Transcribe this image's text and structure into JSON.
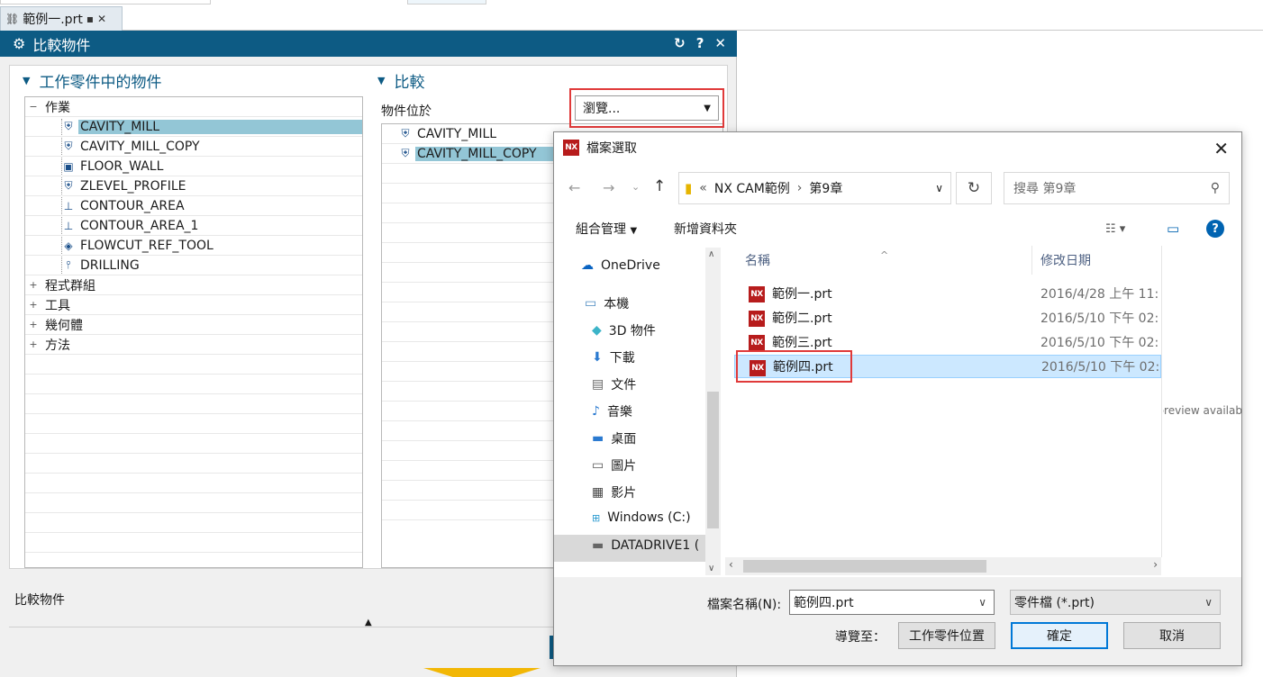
{
  "document_tab": {
    "title": "範例一.prt"
  },
  "compare_dialog": {
    "title": "比較物件",
    "left_section": {
      "header": "工作零件中的物件",
      "tree": {
        "group_ops": "作業",
        "operations": [
          "CAVITY_MILL",
          "CAVITY_MILL_COPY",
          "FLOOR_WALL",
          "ZLEVEL_PROFILE",
          "CONTOUR_AREA",
          "CONTOUR_AREA_1",
          "FLOWCUT_REF_TOOL",
          "DRILLING"
        ],
        "groups": [
          "程式群組",
          "工具",
          "幾何體",
          "方法"
        ]
      }
    },
    "right_section": {
      "header": "比較",
      "location_label": "物件位於",
      "browse_value": "瀏覽...",
      "tree_items": [
        "CAVITY_MILL",
        "CAVITY_MILL_COPY"
      ]
    },
    "bottom_label": "比較物件"
  },
  "file_dialog": {
    "title": "檔案選取",
    "address": {
      "prefix": "«",
      "path1": "NX CAM範例",
      "sep": "›",
      "path2": "第9章"
    },
    "search_placeholder": "搜尋 第9章",
    "toolbar": {
      "organize": "組合管理",
      "new_folder": "新增資料夾"
    },
    "nav_items": [
      "OneDrive",
      "本機",
      "3D 物件",
      "下載",
      "文件",
      "音樂",
      "桌面",
      "圖片",
      "影片",
      "Windows (C:)",
      "DATADRIVE1 ("
    ],
    "columns": {
      "name": "名稱",
      "date": "修改日期"
    },
    "files": [
      {
        "name": "範例一.prt",
        "date": "2016/4/28 上午 11:"
      },
      {
        "name": "範例二.prt",
        "date": "2016/5/10 下午 02:"
      },
      {
        "name": "範例三.prt",
        "date": "2016/5/10 下午 02:"
      },
      {
        "name": "範例四.prt",
        "date": "2016/5/10 下午 02:"
      }
    ],
    "preview_text": "preview availab",
    "filename_label": "檔案名稱(N):",
    "filename_value": "範例四.prt",
    "filetype_value": "零件檔 (*.prt)",
    "navigate_label": "導覽至：",
    "work_part_location": "工作零件位置",
    "ok": "確定",
    "cancel": "取消"
  },
  "colors": {
    "title_bar": "#0d5b84",
    "selection": "#93c6d6",
    "highlight_box": "#e03a3a",
    "file_selection": "#cce8ff",
    "nx_icon": "#b71c1c"
  }
}
